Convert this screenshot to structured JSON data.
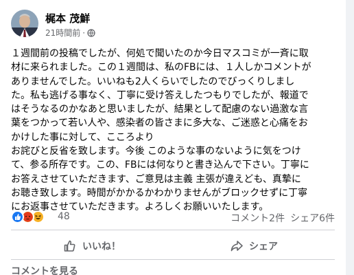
{
  "post": {
    "author": "梶本 茂鮮",
    "timestamp": "21時間前",
    "dot": "·",
    "privacy_icon": "globe-icon",
    "body_lines": [
      "１週間前の投稿でしたが、何処で聞いたのか今日マスコミが一斉に取",
      "材に来られました。この１週間は、私のFBには、１人しかコメントが",
      "ありませんでした。いいねも2人くらいでしたのでびっくりしまし",
      "た。私も逃げる事なく、丁寧に受け答えしたつもりでしたが、報道で",
      "はそうなるのかなあと思いましたが、結果として配慮のない過激な言",
      "葉をつかって若い人や、感染者の皆さまに多大な、ご迷惑と心痛をお",
      "かけした事に対して、こころより",
      "お詫びと反省を致します。今後 このような事のないように気をつけ",
      "て、参る所存です。この、FBには何なりと書き込んで下さい。丁寧に",
      "お答えさせていただきます、ご意見は主義 主張が違えども、真摯に",
      "お聴き致します。時間がかかるかわかりませんがブロックせずに丁寧",
      "にお返事させていただきます。よろしくお願いいたします。"
    ]
  },
  "reactions": {
    "icons": [
      "like-reaction-icon",
      "angry-reaction-icon",
      "haha-reaction-icon"
    ],
    "colors": {
      "like": "#1877f2",
      "angry": "#e9710f",
      "haha": "#f7b125"
    },
    "count": "48",
    "comments": "コメント2件",
    "shares": "シェア6件"
  },
  "actions": {
    "like_label": "いいね！",
    "share_label": "シェア"
  },
  "comments_link": "コメントを見る"
}
